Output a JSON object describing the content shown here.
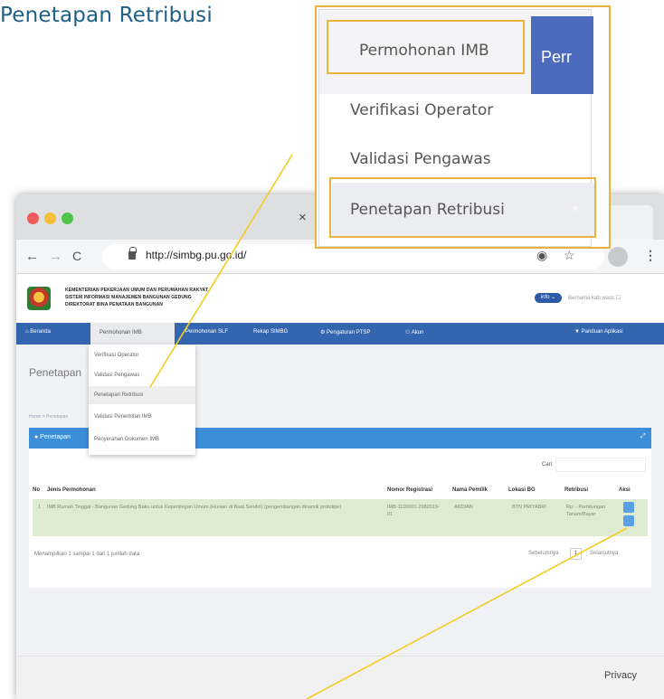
{
  "heading": "Penetapan Retribusi",
  "colors": {
    "heading": "#1f5f86",
    "callout_border": "#eab33d",
    "menu_bar": "#3466b0",
    "card_header": "#3c8ed8",
    "row_highlight": "#dcebd2"
  },
  "zoom": {
    "permohonan_imb": "Permohonan IMB",
    "permohonan_cut": "Perr",
    "verifikasi_operator": "Verifikasi Operator",
    "validasi_pengawas": "Validasi Pengawas",
    "penetapan_retribusi": "Penetapan Retribusi"
  },
  "browser": {
    "tab_close": "×",
    "back": "←",
    "forward": "→",
    "reload": "C",
    "url": "http://simbg.pu.go.id/",
    "location_icon": "target-icon",
    "bookmark_icon": "star-icon",
    "bookmark_glyph": "☆",
    "location_glyph": "◉",
    "menu_icon": "more-vertical-icon",
    "menu_glyph": "⋮"
  },
  "site": {
    "ministry_lines": [
      "KEMENTERIAN PEKERJAAN UMUM DAN PERUMAHAN RAKYAT",
      "SISTEM INFORMASI MANAJEMEN BANGUNAN GEDUNG",
      "DIREKTORAT BINA PENATAAN BANGUNAN"
    ],
    "info_pill": "info ⌄",
    "user_label": "Bernama kab.wass ☐",
    "menu": {
      "beranda": "⌂ Beranda",
      "permohonan_imb": "Permohonan IMB",
      "permohonan_slf": "Permohonan SLF",
      "rekap_simbg": "Rekap SIMBG",
      "pengaturan_ptsp": "⚙ Pengaturan PTSP",
      "akun": "⚇ Akun",
      "panduan": "▼ Panduan Aplikasi"
    },
    "panel_title": "Penetapan",
    "breadcrumb": "Home > Penetapan",
    "dropdown": [
      "Verifikasi Operator",
      "Validasi Pengawas",
      "Penetapan Retribusi",
      "Validasi Penerbitan IMB",
      "Penyerahan Dokumen IMB"
    ],
    "card_title": "● Penetapan",
    "card_expand": "⤢",
    "search_label": "Cari:",
    "table": {
      "headers": [
        "No",
        "Jenis Permohonan",
        "Nomor Registrasi",
        "Nama Pemilik",
        "Lokasi BG",
        "Retribusi",
        "Aksi"
      ],
      "row": {
        "no": "1",
        "jenis": "IMB Rumah Tinggal - Bangunan Gedung Baku untuk Kepentingan Umum (Hunian di Buat Sendiri) (pengembangan dinamik prototipe)",
        "nomor": "IMB-1100001-2982019-01",
        "nama": "ARDIAN",
        "lokasi": "BTN PRIYABRI",
        "retribusi": "Rp. - Perhitungan Tanam/Bayar"
      }
    },
    "footer_text": "Menampilkan 1 sampai 1 dari 1 jumlah data",
    "pager_prev": "Sebelumnya",
    "pager_page": "1",
    "pager_next": "Selanjutnya"
  },
  "privacy": "Privacy"
}
